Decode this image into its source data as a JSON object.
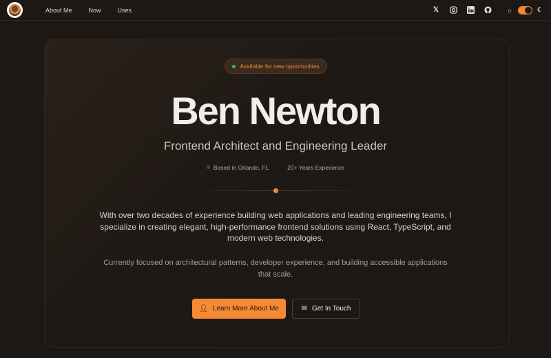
{
  "nav": {
    "links": [
      "About Me",
      "Now",
      "Uses"
    ],
    "social_icons": [
      "x-icon",
      "instagram-icon",
      "linkedin-icon",
      "github-icon"
    ]
  },
  "hero": {
    "badge": "Available for new opportunities",
    "name": "Ben Newton",
    "title": "Frontend Architect and Engineering Leader",
    "location": "Based in Orlando, FL",
    "separator": "·",
    "experience": "20+ Years Experience",
    "paragraph1": "With over two decades of experience building web applications and leading engineering teams, I specialize in creating elegant, high-performance frontend solutions using React, TypeScript, and modern web technologies.",
    "paragraph2": "Currently focused on architectural patterns, developer experience, and building accessible applications that scale.",
    "primary_button": "Learn More About Me",
    "secondary_button": "Get In Touch"
  },
  "colors": {
    "accent": "#f58a35",
    "background": "#1e1814",
    "status": "#3fbf5a"
  }
}
